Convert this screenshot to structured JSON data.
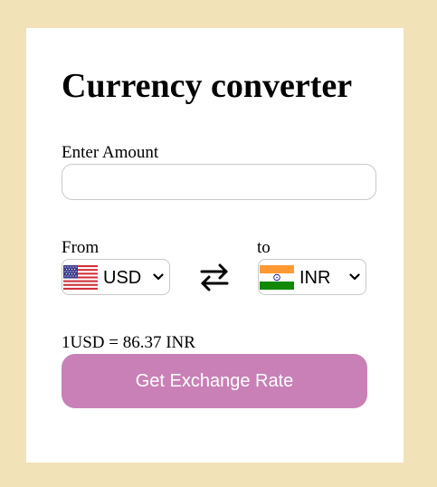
{
  "app": {
    "title": "Currency converter"
  },
  "amount": {
    "label": "Enter Amount",
    "value": "",
    "placeholder": ""
  },
  "from": {
    "label": "From",
    "currency": "USD",
    "flag_icon": "us-flag-icon"
  },
  "to": {
    "label": "to",
    "currency": "INR",
    "flag_icon": "india-flag-icon"
  },
  "swap": {
    "icon": "swap-arrows-icon"
  },
  "rate": {
    "text": "1USD = 86.37 INR"
  },
  "action": {
    "label": "Get Exchange Rate"
  },
  "colors": {
    "page_background": "#f1e2b7",
    "card_background": "#ffffff",
    "button_background": "#c980b6",
    "button_text": "#ffffff",
    "border": "#c9c9c9"
  }
}
